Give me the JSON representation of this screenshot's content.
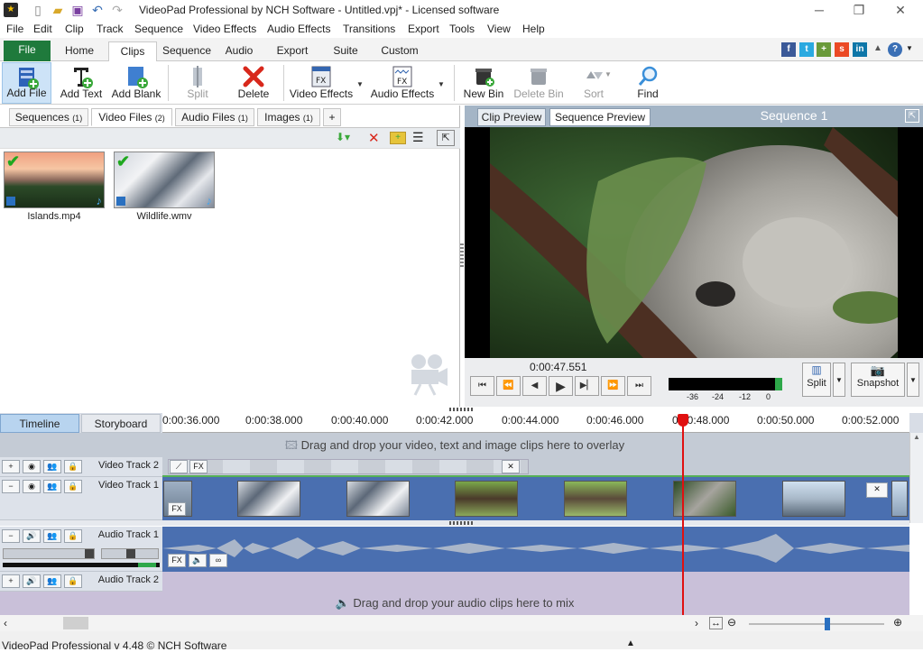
{
  "window": {
    "title": "VideoPad Professional by NCH Software - Untitled.vpj* - Licensed software"
  },
  "menu": [
    "File",
    "Edit",
    "Clip",
    "Track",
    "Sequence",
    "Video Effects",
    "Audio Effects",
    "Transitions",
    "Export",
    "Tools",
    "View",
    "Help"
  ],
  "tabs": [
    "File",
    "Home",
    "Clips",
    "Sequence",
    "Audio",
    "Export",
    "Suite",
    "Custom"
  ],
  "toolbar": {
    "add_file": "Add File",
    "add_text": "Add Text",
    "add_blank": "Add Blank",
    "split": "Split",
    "delete": "Delete",
    "video_effects": "Video Effects",
    "audio_effects": "Audio Effects",
    "new_bin": "New Bin",
    "delete_bin": "Delete Bin",
    "sort": "Sort",
    "find": "Find"
  },
  "bin_tabs": [
    {
      "label": "Sequences",
      "count": "(1)"
    },
    {
      "label": "Video Files",
      "count": "(2)"
    },
    {
      "label": "Audio Files",
      "count": "(1)"
    },
    {
      "label": "Images",
      "count": "(1)"
    },
    {
      "label": "+",
      "count": ""
    }
  ],
  "media": [
    {
      "name": "Islands.mp4"
    },
    {
      "name": "Wildlife.wmv"
    }
  ],
  "preview": {
    "clip_tab": "Clip Preview",
    "seq_tab": "Sequence Preview",
    "seq_title": "Sequence 1",
    "timecode": "0:00:47.551",
    "meter_labels": [
      "-36",
      "-24",
      "-12",
      "0"
    ],
    "split": "Split",
    "snapshot": "Snapshot"
  },
  "timeline": {
    "tab_timeline": "Timeline",
    "tab_storyboard": "Storyboard",
    "ruler": [
      "0:00:36.000",
      "0:00:38.000",
      "0:00:40.000",
      "0:00:42.000",
      "0:00:44.000",
      "0:00:46.000",
      "0:00:48.000",
      "0:00:50.000",
      "0:00:52.000"
    ],
    "overlay_msg": "Drag and drop your video, text and image clips here to overlay",
    "audio_msg": "Drag and drop your audio clips here to mix",
    "tracks": {
      "v2": "Video Track 2",
      "v1": "Video Track 1",
      "a1": "Audio Track 1",
      "a2": "Audio Track 2"
    },
    "fx": "FX"
  },
  "status": "VideoPad Professional v 4.48 © NCH Software",
  "colors": {
    "file_tab": "#1f7a3c",
    "video_track": "#4a6fb0",
    "audio_track": "#4a6fb0",
    "playhead": "#e01010"
  }
}
